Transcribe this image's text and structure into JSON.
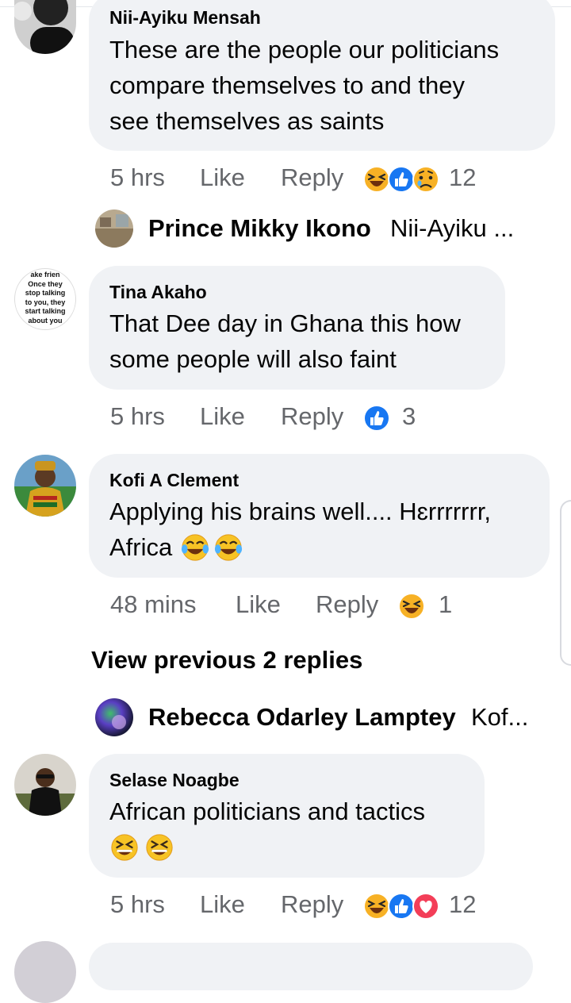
{
  "comments": [
    {
      "author": "Nii-Ayiku Mensah",
      "lines": [
        "These are the people our politicians",
        "compare themselves to and they",
        "see themselves as saints"
      ],
      "time": "5 hrs",
      "like_label": "Like",
      "reply_label": "Reply",
      "reactions": [
        "haha-icon",
        "like-icon",
        "sad-icon"
      ],
      "reaction_count": "12"
    },
    {
      "author": "Tina Akaho",
      "lines": [
        "That Dee day in Ghana this how",
        "some people will also faint"
      ],
      "time": "5 hrs",
      "like_label": "Like",
      "reply_label": "Reply",
      "reactions": [
        "like-icon"
      ],
      "reaction_count": "3",
      "avatar_text": [
        "ake frien",
        "Once they",
        "stop talking",
        "to you, they",
        "start talking",
        "about you"
      ]
    },
    {
      "author": "Kofi A Clement",
      "lines": [
        "Applying his brains well.... Hɛrrrrrrr,",
        "Africa"
      ],
      "time": "48 mins",
      "like_label": "Like",
      "reply_label": "Reply",
      "reactions": [
        "haha-icon"
      ],
      "reaction_count": "1"
    },
    {
      "author": "Selase Noagbe",
      "lines": [
        "African politicians and tactics"
      ],
      "time": "5 hrs",
      "like_label": "Like",
      "reply_label": "Reply",
      "reactions": [
        "haha-icon",
        "like-icon",
        "love-icon"
      ],
      "reaction_count": "12"
    }
  ],
  "replies": [
    {
      "name": "Prince Mikky Ikono",
      "snippet": "Nii-Ayiku ..."
    },
    {
      "name": "Rebecca Odarley Lamptey",
      "snippet": "Kof..."
    }
  ],
  "view_previous": "View previous 2 replies",
  "colors": {
    "bubble": "#f0f2f5",
    "meta": "#65676b",
    "like": "#1877f2",
    "love": "#f33e58",
    "haha": "#f7b125"
  }
}
